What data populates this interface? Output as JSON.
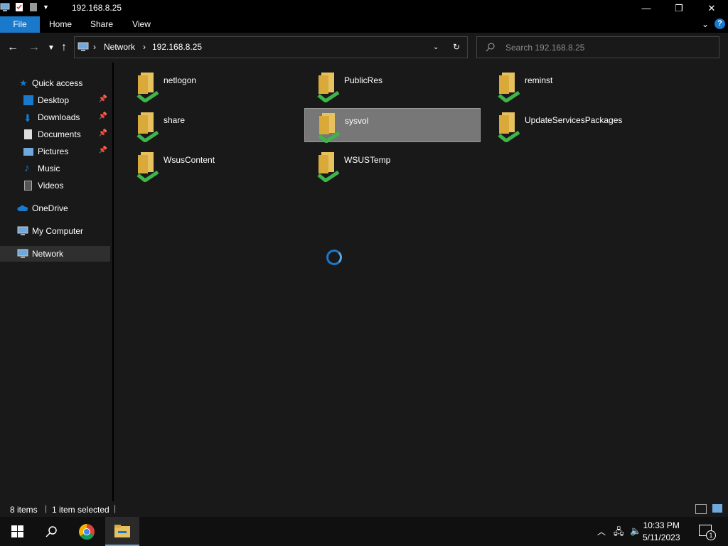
{
  "window": {
    "title": "192.168.8.25"
  },
  "ribbon": {
    "tabs": [
      "File",
      "Home",
      "Share",
      "View"
    ]
  },
  "address": {
    "segments": [
      "Network",
      "192.168.8.25"
    ]
  },
  "search": {
    "placeholder": "Search 192.168.8.25"
  },
  "sidebar": {
    "items": [
      {
        "label": "Quick access",
        "icon": "star-icon"
      },
      {
        "label": "Desktop",
        "icon": "desktop-icon",
        "pinned": true
      },
      {
        "label": "Downloads",
        "icon": "download-arrow-icon",
        "pinned": true
      },
      {
        "label": "Documents",
        "icon": "document-icon",
        "pinned": true
      },
      {
        "label": "Pictures",
        "icon": "pictures-icon",
        "pinned": true
      },
      {
        "label": "Music",
        "icon": "music-note-icon"
      },
      {
        "label": "Videos",
        "icon": "video-icon"
      },
      {
        "label": "OneDrive",
        "icon": "cloud-icon"
      },
      {
        "label": "My Computer",
        "icon": "computer-icon"
      },
      {
        "label": "Network",
        "icon": "network-icon",
        "selected": true
      }
    ]
  },
  "folders": [
    {
      "name": "netlogon"
    },
    {
      "name": "PublicRes"
    },
    {
      "name": "reminst"
    },
    {
      "name": "share"
    },
    {
      "name": "sysvol",
      "selected": true
    },
    {
      "name": "UpdateServicesPackages"
    },
    {
      "name": "WsusContent"
    },
    {
      "name": "WSUSTemp"
    }
  ],
  "status": {
    "count": "8 items",
    "selection": "1 item selected"
  },
  "taskbar": {
    "time": "10:33 PM",
    "date": "5/11/2023",
    "notifications": "1"
  },
  "colors": {
    "accent": "#1979ca",
    "background": "#191919",
    "folder": "#e8c15f",
    "share_cable": "#3cb54a"
  }
}
